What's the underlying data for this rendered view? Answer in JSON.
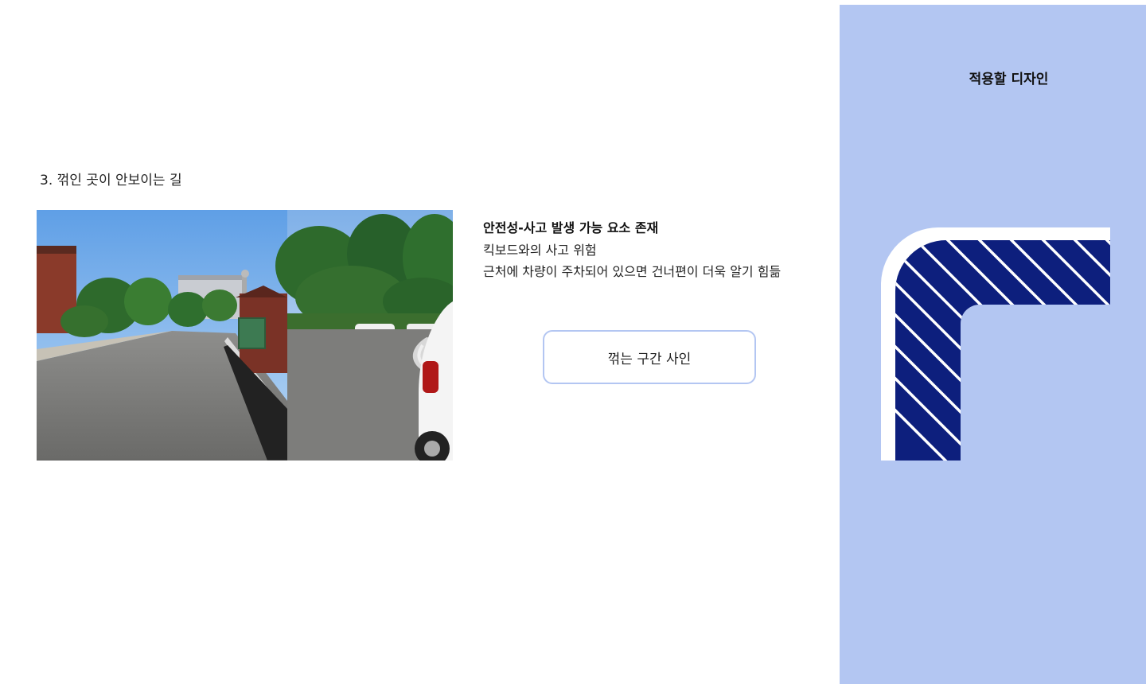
{
  "section": {
    "title": "3. 꺾인 곳이 안보이는 길"
  },
  "photos": {
    "left_scene": "campus-road-photo",
    "right_scene": "parking-lot-photo"
  },
  "info": {
    "heading": "안전성-사고 발생 가능 요소 존재",
    "line1": "킥보드와의 사고 위험",
    "line2": "근처에 차량이 주차되어 있으면 건너편이 더욱 알기 힘듦"
  },
  "sign_button": {
    "label": "꺾는 구간 사인"
  },
  "design_panel": {
    "title": "적용할 디자인",
    "panel_color": "#b3c6f2",
    "stripe_color": "#0d1f7d"
  }
}
